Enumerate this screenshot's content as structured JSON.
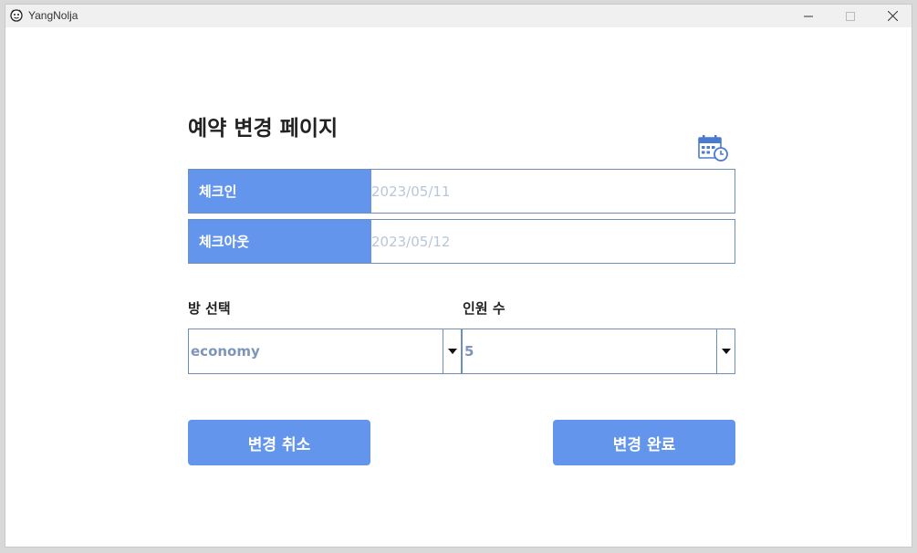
{
  "window": {
    "title": "YangNolja"
  },
  "page": {
    "title": "예약 변경 페이지"
  },
  "icons": {
    "app": "yangnolja-app-icon",
    "calendar": "calendar-clock-icon"
  },
  "checkin": {
    "label": "체크인",
    "value": "2023/05/11"
  },
  "checkout": {
    "label": "체크아웃",
    "value": "2023/05/12"
  },
  "room": {
    "label": "방 선택",
    "selected": "economy"
  },
  "people": {
    "label": "인원 수",
    "selected": "5"
  },
  "buttons": {
    "cancel": "변경 취소",
    "confirm": "변경 완료"
  },
  "colors": {
    "accent": "#6495ed",
    "border": "#6d8fb8",
    "placeholder": "#b7c7d8",
    "combo_text": "#7d96b8"
  }
}
